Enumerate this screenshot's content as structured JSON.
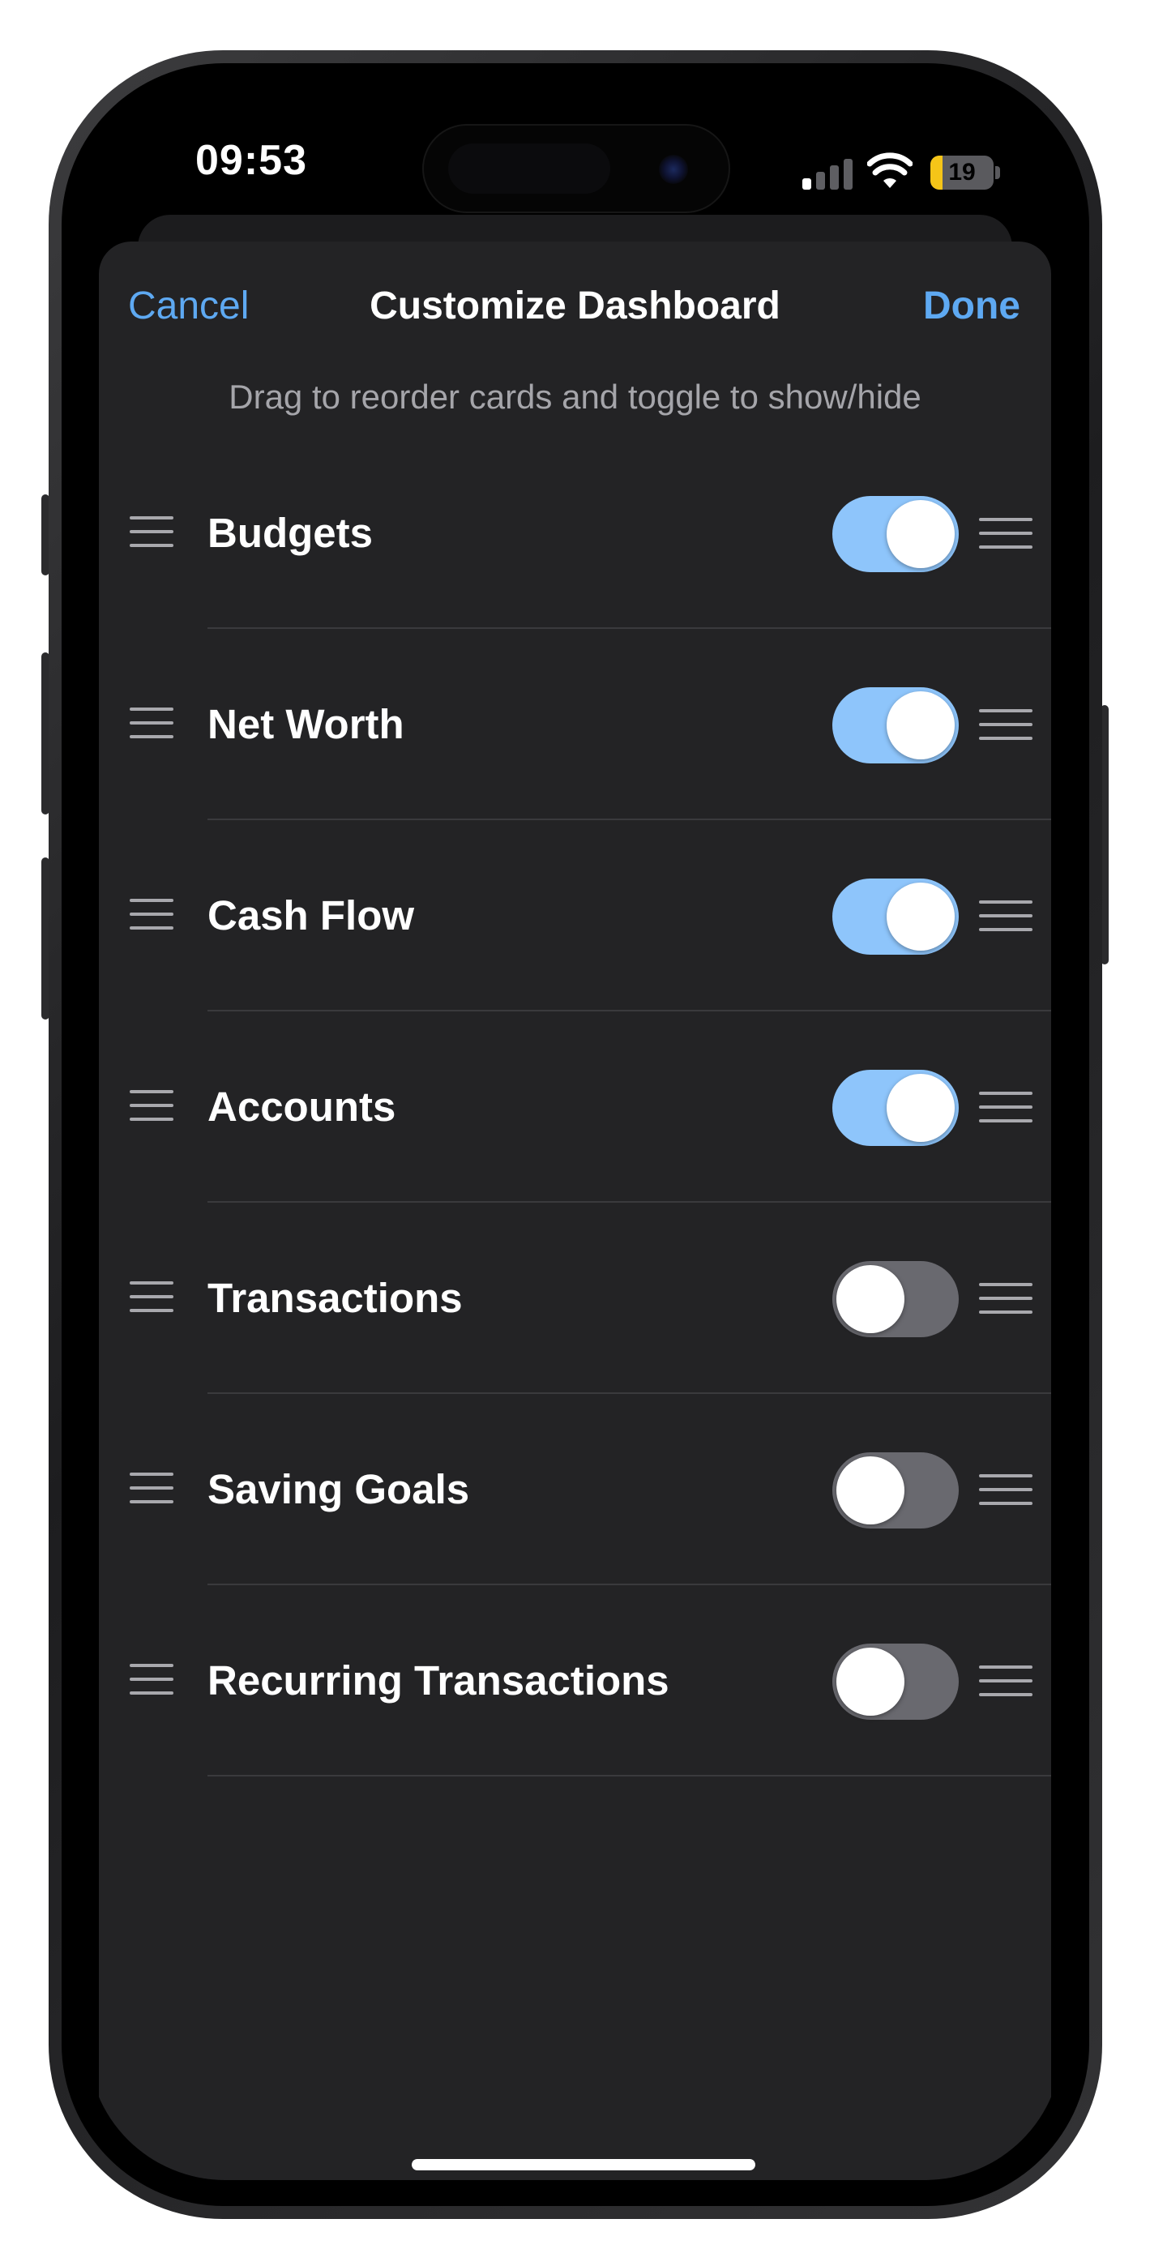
{
  "status_bar": {
    "time": "09:53",
    "battery_level": "19",
    "battery_fraction": 0.19,
    "signal_bars_active": 1,
    "signal_bars_total": 4
  },
  "nav": {
    "cancel_label": "Cancel",
    "title": "Customize Dashboard",
    "done_label": "Done"
  },
  "subtitle": "Drag to reorder cards and toggle to show/hide",
  "cards": [
    {
      "label": "Budgets",
      "enabled": true
    },
    {
      "label": "Net Worth",
      "enabled": true
    },
    {
      "label": "Cash Flow",
      "enabled": true
    },
    {
      "label": "Accounts",
      "enabled": true
    },
    {
      "label": "Transactions",
      "enabled": false
    },
    {
      "label": "Saving Goals",
      "enabled": false
    },
    {
      "label": "Recurring Transactions",
      "enabled": false
    }
  ],
  "icons": {
    "drag_handle": "drag-handle-icon",
    "reorder": "reorder-icon",
    "wifi": "wifi-icon",
    "signal": "cellular-signal-icon",
    "battery": "battery-icon"
  },
  "colors": {
    "accent": "#5ea9f2",
    "toggle_on": "#8ec5fb",
    "toggle_off": "#69696f",
    "sheet_background": "#232325",
    "battery_low": "#f5c518"
  }
}
